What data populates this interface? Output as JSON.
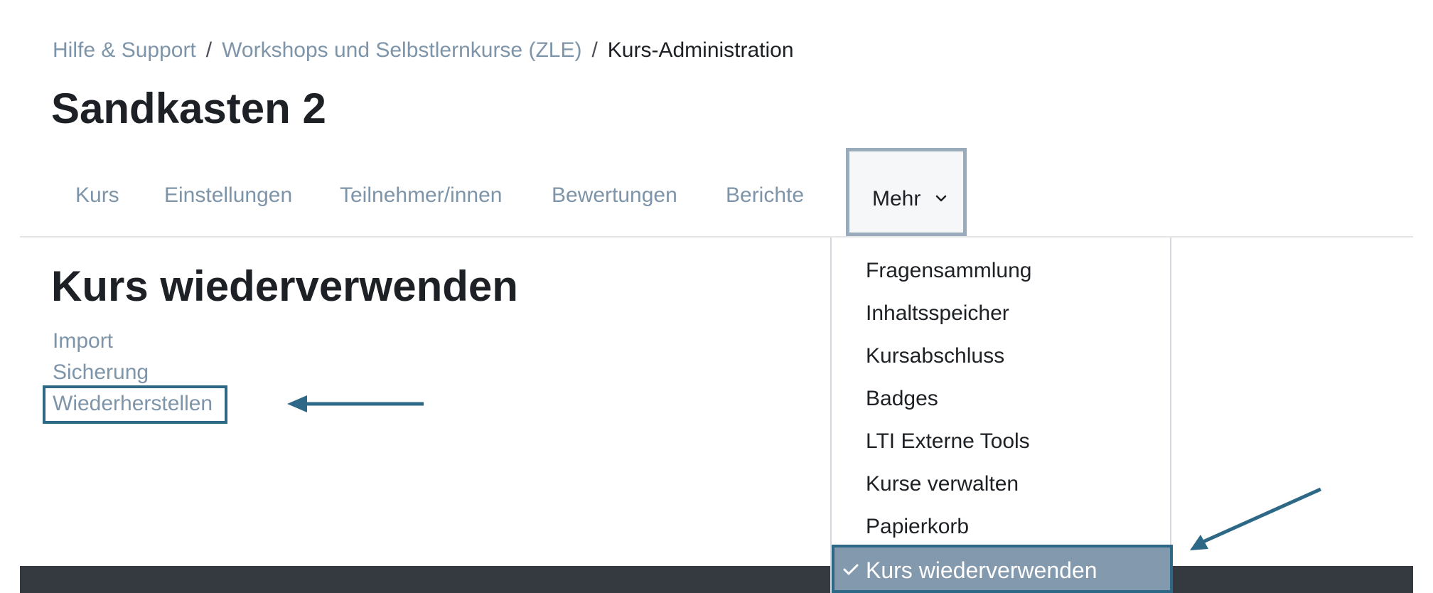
{
  "breadcrumb": {
    "items": [
      {
        "label": "Hilfe & Support"
      },
      {
        "label": "Workshops und Selbstlernkurse (ZLE)"
      },
      {
        "label": "Kurs-Administration"
      }
    ],
    "separator": "/"
  },
  "page_title": "Sandkasten 2",
  "nav": {
    "tabs": [
      {
        "label": "Kurs"
      },
      {
        "label": "Einstellungen"
      },
      {
        "label": "Teilnehmer/innen"
      },
      {
        "label": "Bewertungen"
      },
      {
        "label": "Berichte"
      }
    ],
    "more_label": "Mehr",
    "more_icon": "chevron-down-icon"
  },
  "section": {
    "title": "Kurs wiederverwenden",
    "links": [
      {
        "label": "Import"
      },
      {
        "label": "Sicherung"
      },
      {
        "label": "Wiederherstellen"
      }
    ]
  },
  "dropdown": {
    "items": [
      {
        "label": "Fragensammlung"
      },
      {
        "label": "Inhaltsspeicher"
      },
      {
        "label": "Kursabschluss"
      },
      {
        "label": "Badges"
      },
      {
        "label": "LTI Externe Tools"
      },
      {
        "label": "Kurse verwalten"
      },
      {
        "label": "Papierkorb"
      }
    ],
    "selected": {
      "label": "Kurs wiederverwenden",
      "icon": "check-icon"
    }
  },
  "colors": {
    "link": "#7e94a8",
    "annotation": "#2d6987",
    "selected_bg": "#8399ad",
    "footer": "#343a40"
  }
}
